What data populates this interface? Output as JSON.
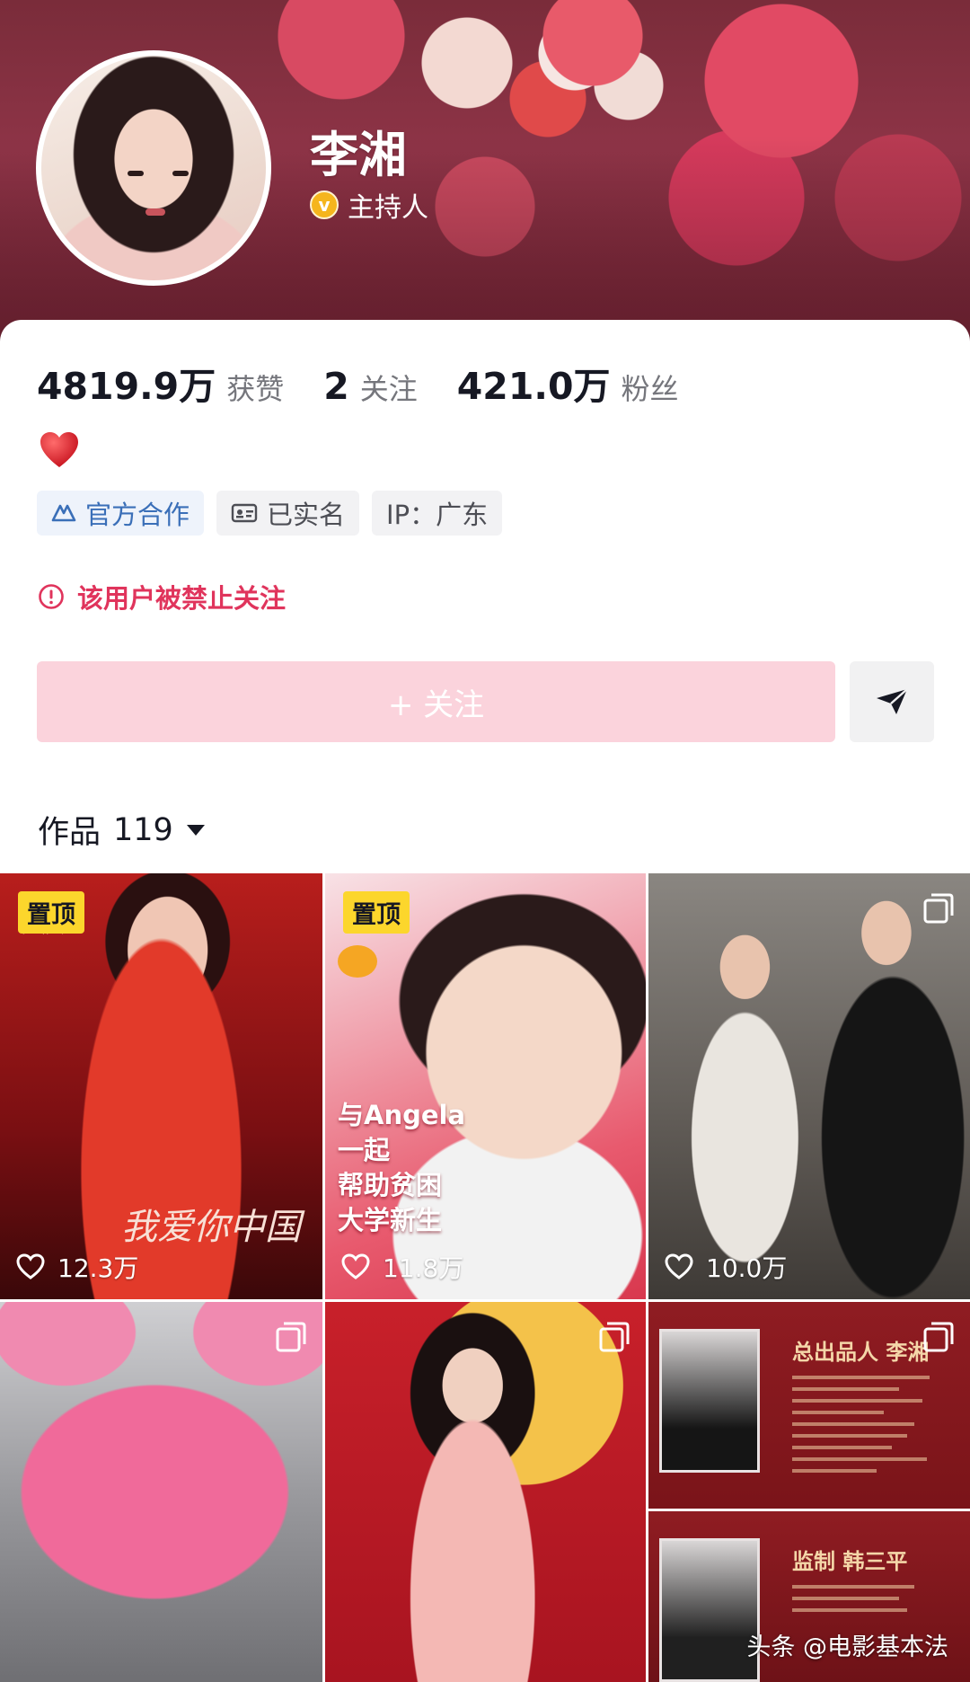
{
  "profile": {
    "name": "李湘",
    "verify_label": "主持人",
    "verify_badge": "v"
  },
  "stats": [
    {
      "value": "4819.9万",
      "label": "获赞"
    },
    {
      "value": "2",
      "label": "关注"
    },
    {
      "value": "421.0万",
      "label": "粉丝"
    }
  ],
  "bio_emoji": "heart-emoji",
  "tags": {
    "official": "官方合作",
    "realname": "已实名",
    "ip": "IP：广东"
  },
  "notice": "该用户被禁止关注",
  "actions": {
    "follow_label": "+ 关注",
    "share_icon": "send-icon"
  },
  "works": {
    "label": "作品",
    "count": "119"
  },
  "grid": {
    "pinned_label": "置顶",
    "items": [
      {
        "likes": "12.3万",
        "caption": "我爱你中国"
      },
      {
        "likes": "11.8万",
        "caption_lines": [
          "与Angela",
          "一起",
          "帮助贫困",
          "大学新生"
        ]
      },
      {
        "likes": "10.0万"
      }
    ],
    "credits": [
      {
        "title": "总出品人 李湘"
      },
      {
        "title": "监制 韩三平"
      }
    ]
  },
  "watermark": "头条 @电影基本法",
  "colors": {
    "accent_pink": "#fbd3dc",
    "warning_red": "#e0345c",
    "pin_yellow": "#fcd62c",
    "official_blue": "#3a6fb8",
    "verify_gold": "#f5b51d"
  }
}
